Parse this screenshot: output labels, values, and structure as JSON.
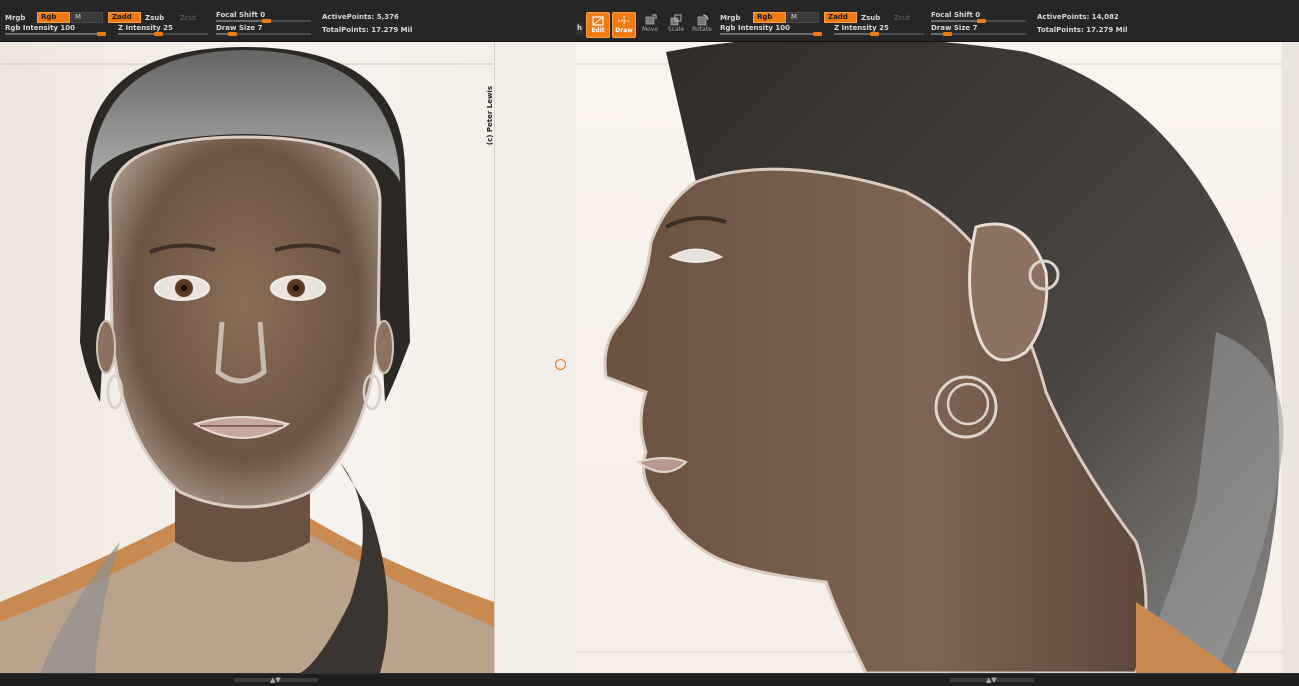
{
  "left_toolbar": {
    "mrgb": "Mrgb",
    "rgb": "Rgb",
    "m": "M",
    "zadd": "Zadd",
    "zsub": "Zsub",
    "zcut": "Zcut",
    "rgb_intensity": "Rgb Intensity 100",
    "rgb_intensity_value": 100,
    "z_intensity": "Z Intensity 25",
    "z_intensity_value": 25,
    "focal_shift": "Focal Shift 0",
    "focal_shift_value": 0,
    "draw_size": "Draw Size 7",
    "draw_size_value": 7,
    "active_points": "ActivePoints: 5,376",
    "total_points": "TotalPoints: 17.279 Mil"
  },
  "right_toolbar": {
    "h_label": "h",
    "edit": "Edit",
    "draw": "Draw",
    "move": "Move",
    "scale": "Scale",
    "rotate": "Rotate",
    "mrgb": "Mrgb",
    "rgb": "Rgb",
    "m": "M",
    "zadd": "Zadd",
    "zsub": "Zsub",
    "zcut": "Zcut",
    "rgb_intensity": "Rgb Intensity 100",
    "rgb_intensity_value": 100,
    "z_intensity": "Z Intensity 25",
    "z_intensity_value": 25,
    "focal_shift": "Focal Shift 0",
    "focal_shift_value": 0,
    "draw_size": "Draw Size 7",
    "draw_size_value": 7,
    "active_points": "ActivePoints: 14,082",
    "total_points": "TotalPoints: 17.279 Mil"
  },
  "watermark": "(c) Peter Lewis",
  "colors": {
    "accent": "#ee7a12",
    "toolbar_bg": "#262626",
    "canvas_bg": "#f6efe8"
  },
  "icons": {
    "edit": "edit-icon",
    "draw": "draw-icon",
    "move": "move-icon",
    "scale": "scale-icon",
    "rotate": "rotate-icon"
  }
}
